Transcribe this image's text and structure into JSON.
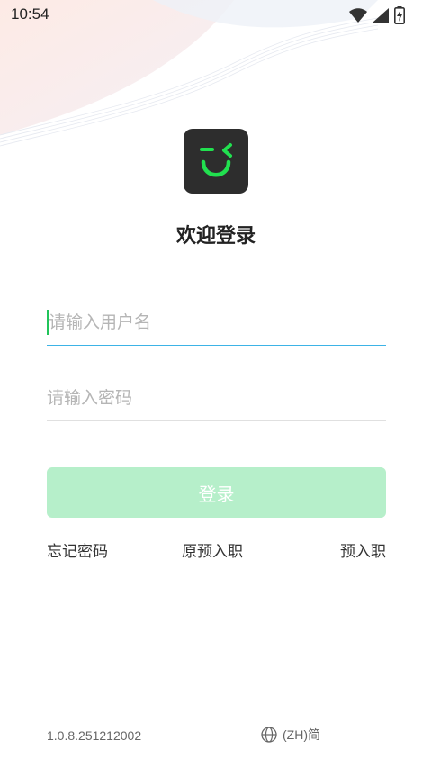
{
  "status_bar": {
    "time": "10:54",
    "icons": [
      "wifi-icon",
      "signal-icon",
      "battery-charging-icon"
    ]
  },
  "logo": {
    "icon": "wink-smile-icon",
    "accent": "#21e04f",
    "background": "#2d2d2d"
  },
  "title": "欢迎登录",
  "form": {
    "username_placeholder": "请输入用户名",
    "username_value": "",
    "password_placeholder": "请输入密码",
    "password_value": ""
  },
  "login_button": {
    "label": "登录",
    "color": "#b6efca"
  },
  "links": {
    "forgot_password": "忘记密码",
    "original_pre_entry": "原预入职",
    "pre_entry": "预入职"
  },
  "footer": {
    "version": "1.0.8.251212002",
    "language": "(ZH)简",
    "language_icon": "globe-icon"
  }
}
